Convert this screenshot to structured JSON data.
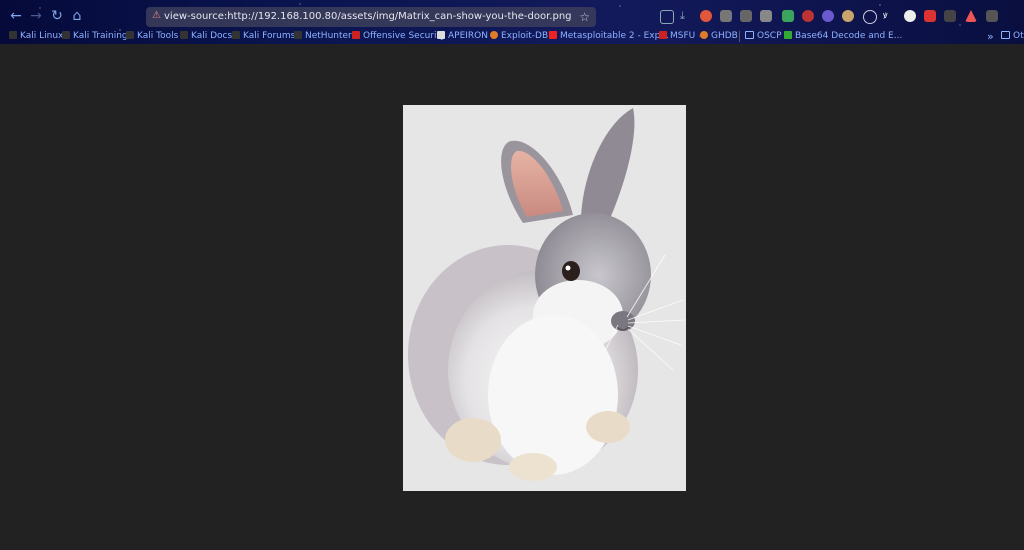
{
  "browser": {
    "url": "view-source:http://192.168.100.80/assets/img/Matrix_can-show-you-the-door.png",
    "bookmarks": [
      {
        "label": "Kali Linux",
        "icon": "kali-icon"
      },
      {
        "label": "Kali Training",
        "icon": "kali-icon"
      },
      {
        "label": "Kali Tools",
        "icon": "kali-icon"
      },
      {
        "label": "Kali Docs",
        "icon": "kali-icon"
      },
      {
        "label": "Kali Forums",
        "icon": "kali-icon"
      },
      {
        "label": "NetHunter",
        "icon": "kali-icon"
      },
      {
        "label": "Offensive Security",
        "icon": "offsec-icon"
      },
      {
        "label": "APEIRON",
        "icon": "page-icon"
      },
      {
        "label": "Exploit-DB",
        "icon": "exploitdb-icon"
      },
      {
        "label": "Metasploitable 2 - Exp...",
        "icon": "youtube-icon"
      },
      {
        "label": "MSFU",
        "icon": "offsec-icon"
      },
      {
        "label": "GHDB",
        "icon": "exploitdb-icon"
      },
      {
        "label": "OSCP",
        "icon": "folder-icon"
      },
      {
        "label": "Base64 Decode and E...",
        "icon": "b64-icon"
      },
      {
        "label": "Ot",
        "icon": "folder-icon"
      }
    ],
    "overflow_label": "»"
  },
  "page": {
    "image_subject": "white and grey rabbit photo"
  },
  "colors": {
    "page_bg": "#222222",
    "link": "#8fb2ff"
  }
}
